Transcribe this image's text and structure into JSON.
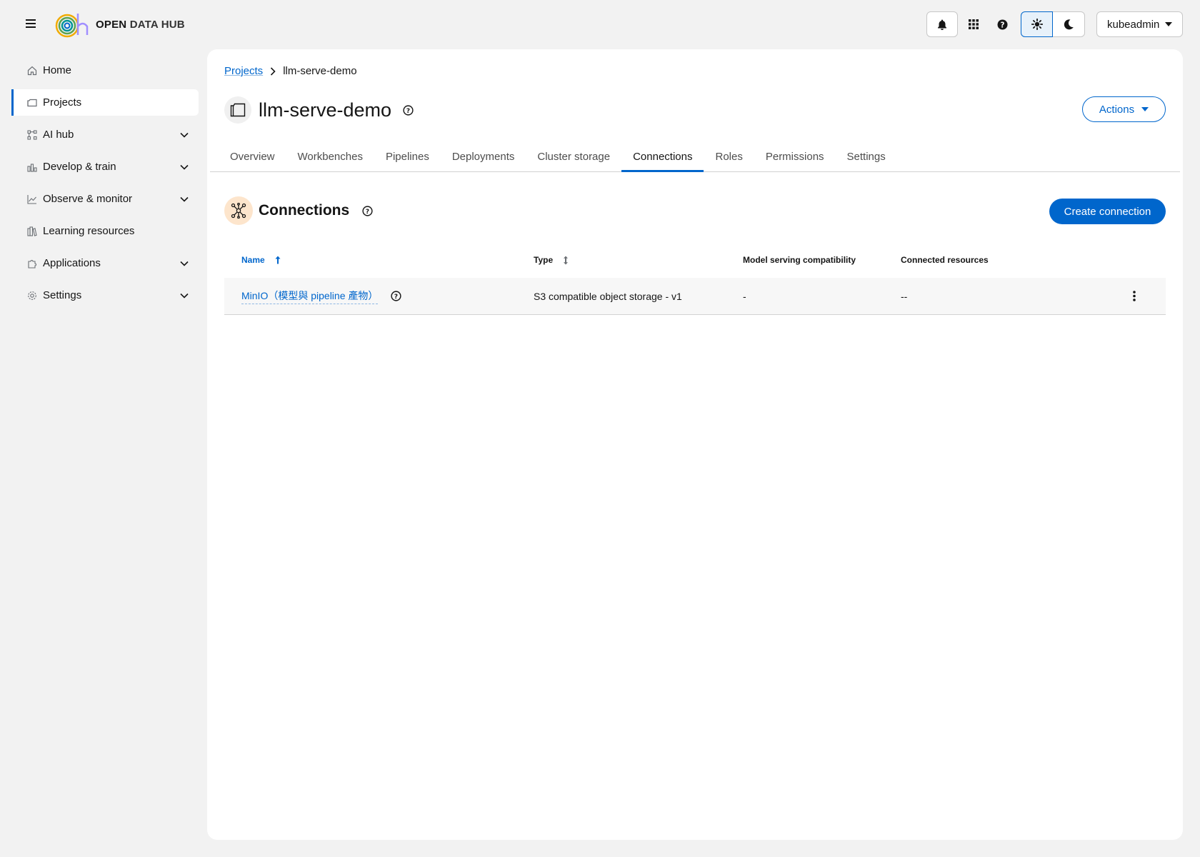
{
  "masthead": {
    "brand_bold": "OPEN",
    "brand_rest": "DATA HUB",
    "user": "kubeadmin",
    "icons": [
      "menu-icon",
      "bell-icon",
      "app-launcher-icon",
      "help-icon",
      "sun-icon",
      "moon-icon",
      "caret-down-icon"
    ]
  },
  "sidebar": {
    "items": [
      {
        "label": "Home",
        "icon": "home-icon"
      },
      {
        "label": "Projects",
        "icon": "folder-icon"
      },
      {
        "label": "AI hub",
        "icon": "ai-hub-icon"
      },
      {
        "label": "Develop & train",
        "icon": "flask-icon"
      },
      {
        "label": "Observe & monitor",
        "icon": "chart-line-icon"
      },
      {
        "label": "Learning resources",
        "icon": "book-icon"
      },
      {
        "label": "Applications",
        "icon": "puzzle-icon"
      },
      {
        "label": "Settings",
        "icon": "cog-icon"
      }
    ]
  },
  "breadcrumb": {
    "parent": "Projects",
    "current": "llm-serve-demo"
  },
  "page": {
    "title": "llm-serve-demo",
    "actions_label": "Actions"
  },
  "tabs": [
    "Overview",
    "Workbenches",
    "Pipelines",
    "Deployments",
    "Cluster storage",
    "Connections",
    "Roles",
    "Permissions",
    "Settings"
  ],
  "section": {
    "title": "Connections",
    "create_label": "Create connection"
  },
  "table": {
    "columns": [
      "Name",
      "Type",
      "Model serving compatibility",
      "Connected resources"
    ],
    "rows": [
      {
        "name": "MinIO（模型與 pipeline 產物）",
        "type": "S3 compatible object storage - v1",
        "compat": "-",
        "resources": "--"
      }
    ]
  }
}
